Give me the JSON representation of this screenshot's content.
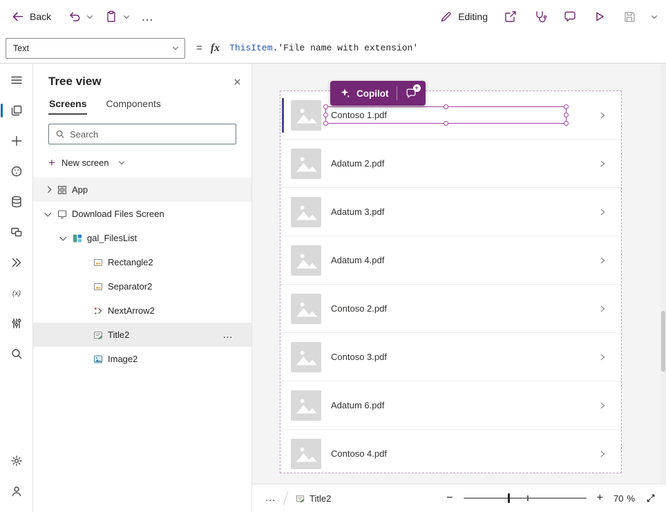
{
  "colors": {
    "brand": "#742774",
    "selection": "#a43fa4",
    "item_indicator": "#444791",
    "formula_identifier": "#2056b0"
  },
  "topbar": {
    "back_label": "Back",
    "more_glyph": "…",
    "editing_label": "Editing"
  },
  "formula_bar": {
    "property_value": "Text",
    "equals_glyph": "=",
    "fx_glyph": "fx",
    "tokens": {
      "identifier": "ThisItem",
      "dot": ".",
      "property": "'File name with extension'"
    }
  },
  "rail": {
    "items": [
      {
        "name": "menu"
      },
      {
        "name": "tree-view",
        "active": true
      },
      {
        "name": "insert"
      },
      {
        "name": "theme"
      },
      {
        "name": "data"
      },
      {
        "name": "media"
      },
      {
        "name": "power-automate"
      },
      {
        "name": "variables"
      },
      {
        "name": "advanced-tools"
      },
      {
        "name": "search"
      }
    ],
    "bottom_items": [
      {
        "name": "settings"
      },
      {
        "name": "help"
      }
    ]
  },
  "tree_view": {
    "title": "Tree view",
    "tabs": [
      {
        "label": "Screens",
        "active": true
      },
      {
        "label": "Components",
        "active": false
      }
    ],
    "search_placeholder": "Search",
    "new_screen_label": "New screen",
    "new_screen_plus": "+",
    "more_glyph": "…",
    "nodes": [
      {
        "label": "App",
        "level": 0,
        "icon": "app",
        "expandable": true,
        "expanded": false,
        "shaded": true
      },
      {
        "label": "Download Files Screen",
        "level": 0,
        "icon": "screen",
        "expandable": true,
        "expanded": true
      },
      {
        "label": "gal_FilesList",
        "level": 1,
        "icon": "gallery",
        "expandable": true,
        "expanded": true
      },
      {
        "label": "Rectangle2",
        "level": 2,
        "icon": "shape"
      },
      {
        "label": "Separator2",
        "level": 2,
        "icon": "shape"
      },
      {
        "label": "NextArrow2",
        "level": 2,
        "icon": "arrow"
      },
      {
        "label": "Title2",
        "level": 2,
        "icon": "title",
        "selected": true
      },
      {
        "label": "Image2",
        "level": 2,
        "icon": "image"
      }
    ]
  },
  "canvas": {
    "copilot_label": "Copilot",
    "copilot_badge": "+",
    "gallery": {
      "items": [
        {
          "title": "Contoso 1.pdf",
          "selected": true
        },
        {
          "title": "Adatum 2.pdf"
        },
        {
          "title": "Adatum 3.pdf"
        },
        {
          "title": "Adatum 4.pdf"
        },
        {
          "title": "Contoso 2.pdf"
        },
        {
          "title": "Contoso 3.pdf"
        },
        {
          "title": "Adatum 6.pdf"
        },
        {
          "title": "Contoso 4.pdf"
        }
      ]
    }
  },
  "status_bar": {
    "more_glyph": "…",
    "selected_control": "Title2",
    "zoom_out_glyph": "−",
    "zoom_in_glyph": "+",
    "zoom_value": "70",
    "percent_glyph": "%"
  }
}
